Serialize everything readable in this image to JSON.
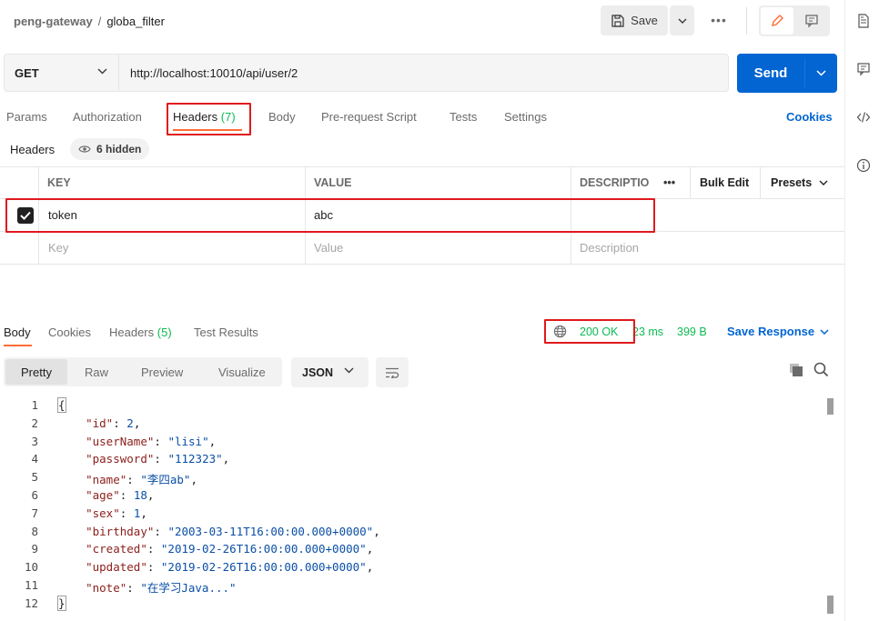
{
  "breadcrumb": {
    "parent": "peng-gateway",
    "separator": "/",
    "current": "globa_filter"
  },
  "toolbar": {
    "save_label": "Save",
    "more_label": "•••"
  },
  "request": {
    "method": "GET",
    "url": "http://localhost:10010/api/user/2",
    "send_label": "Send"
  },
  "request_tabs": {
    "params": "Params",
    "authorization": "Authorization",
    "headers": "Headers",
    "headers_count": "(7)",
    "body": "Body",
    "pre_request": "Pre-request Script",
    "tests": "Tests",
    "settings": "Settings",
    "cookies": "Cookies"
  },
  "headers_section": {
    "title": "Headers",
    "hidden_label": "6 hidden"
  },
  "table": {
    "col_key": "KEY",
    "col_value": "VALUE",
    "col_description": "DESCRIPTIO",
    "more": "•••",
    "bulk_edit": "Bulk Edit",
    "presets": "Presets",
    "rows": [
      {
        "key": "token",
        "value": "abc",
        "checked": true
      }
    ],
    "placeholder_key": "Key",
    "placeholder_value": "Value",
    "placeholder_description": "Description"
  },
  "response_tabs": {
    "body": "Body",
    "cookies": "Cookies",
    "headers": "Headers",
    "headers_count": "(5)",
    "test_results": "Test Results"
  },
  "response_status": {
    "status": "200 OK",
    "time": "23 ms",
    "size": "399 B",
    "save_response": "Save Response"
  },
  "response_view": {
    "pretty": "Pretty",
    "raw": "Raw",
    "preview": "Preview",
    "visualize": "Visualize",
    "format": "JSON"
  },
  "code_lines": [
    {
      "n": "1",
      "t": "{"
    },
    {
      "n": "2",
      "k": "\"id\"",
      "v": "2",
      "kind": "num"
    },
    {
      "n": "3",
      "k": "\"userName\"",
      "v": "\"lisi\"",
      "kind": "str"
    },
    {
      "n": "4",
      "k": "\"password\"",
      "v": "\"112323\"",
      "kind": "str"
    },
    {
      "n": "5",
      "k": "\"name\"",
      "v": "\"李四ab\"",
      "kind": "str"
    },
    {
      "n": "6",
      "k": "\"age\"",
      "v": "18",
      "kind": "num"
    },
    {
      "n": "7",
      "k": "\"sex\"",
      "v": "1",
      "kind": "num"
    },
    {
      "n": "8",
      "k": "\"birthday\"",
      "v": "\"2003-03-11T16:00:00.000+0000\"",
      "kind": "str"
    },
    {
      "n": "9",
      "k": "\"created\"",
      "v": "\"2019-02-26T16:00:00.000+0000\"",
      "kind": "str"
    },
    {
      "n": "10",
      "k": "\"updated\"",
      "v": "\"2019-02-26T16:00:00.000+0000\"",
      "kind": "str"
    },
    {
      "n": "11",
      "k": "\"note\"",
      "v": "\"在学习Java...\"",
      "kind": "str",
      "last": true
    },
    {
      "n": "12",
      "t": "}"
    }
  ],
  "colors": {
    "accent": "#0265d2",
    "active_tab": "#ff6c37",
    "success": "#0cbb52",
    "highlight": "#e0191d"
  }
}
